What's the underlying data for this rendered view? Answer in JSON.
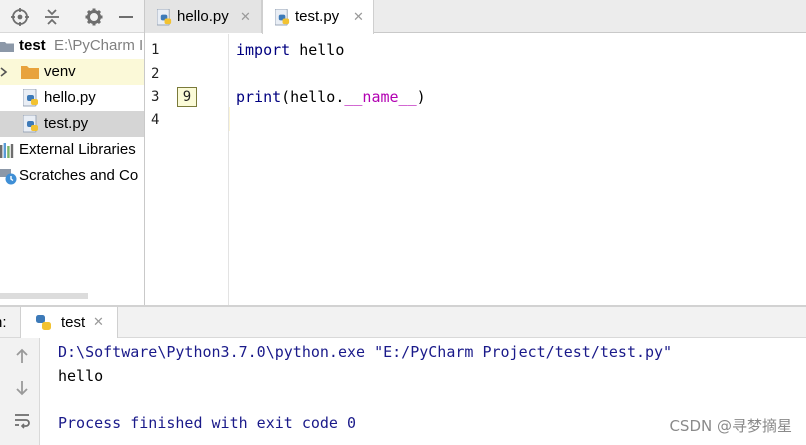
{
  "project": {
    "root_name": "test",
    "root_path": "E:\\PyCharm I",
    "items": [
      {
        "label": "venv"
      },
      {
        "label": "hello.py"
      },
      {
        "label": "test.py"
      }
    ],
    "external_libraries": "External Libraries",
    "scratches": "Scratches and Co"
  },
  "editor": {
    "tabs": [
      {
        "label": "hello.py",
        "close": "✕"
      },
      {
        "label": "test.py",
        "close": "✕"
      }
    ],
    "line_numbers": [
      "1",
      "2",
      "3",
      "4"
    ],
    "usage_badge": "9",
    "code": {
      "l1_kw": "import",
      "l1_rest": " hello",
      "l3_fn": "print",
      "l3_pre": "(hello.",
      "l3_dunder": "__name__",
      "l3_post": ")"
    }
  },
  "run": {
    "label": "n:",
    "tab_label": "test",
    "tab_close": "✕",
    "console": [
      "D:\\Software\\Python3.7.0\\python.exe \"E:/PyCharm Project/test/test.py\"",
      "hello",
      "",
      "Process finished with exit code 0"
    ]
  },
  "watermark": "CSDN @寻梦摘星",
  "colors": {
    "accent_folder": "#e8a33d",
    "current_line": "#fcf5d6",
    "keyword": "#000080",
    "dunder": "#b200b2",
    "console_text": "#1a1a8a"
  }
}
